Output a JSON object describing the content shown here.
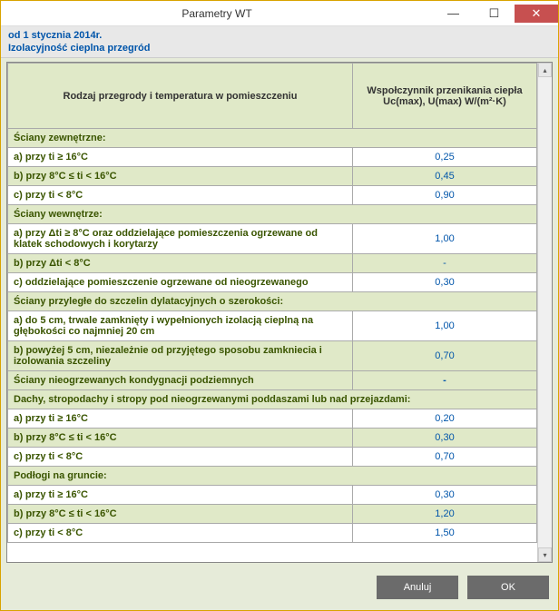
{
  "window": {
    "title": "Parametry WT"
  },
  "info": {
    "line1": "od 1 stycznia 2014r.",
    "line2": "Izolacyjność cieplna przegród"
  },
  "headers": {
    "col1": "Rodzaj przegrody i temperatura w pomieszczeniu",
    "col2": "Wspołczynnik przenikania ciepła Uc(max), U(max) W/(m²·K)"
  },
  "rows": [
    {
      "type": "section",
      "desc": "Ściany zewnętrzne:",
      "val": ""
    },
    {
      "type": "data",
      "desc": "a) przy ti ≥ 16°C",
      "val": "0,25"
    },
    {
      "type": "alt",
      "desc": "b) przy 8°C ≤ ti < 16°C",
      "val": "0,45"
    },
    {
      "type": "data",
      "desc": "c) przy ti < 8°C",
      "val": "0,90"
    },
    {
      "type": "section",
      "desc": "Ściany wewnętrze:",
      "val": ""
    },
    {
      "type": "data",
      "desc": "a) przy Δti ≥ 8°C oraz oddzielające pomieszczenia ogrzewane od klatek schodowych i korytarzy",
      "val": "1,00"
    },
    {
      "type": "alt",
      "desc": "b) przy Δti < 8°C",
      "val": "-"
    },
    {
      "type": "data",
      "desc": "c) oddzielające pomieszczenie ogrzewane od nieogrzewanego",
      "val": "0,30"
    },
    {
      "type": "section",
      "desc": "Ściany przyległe do szczelin dylatacyjnych o szerokości:",
      "val": ""
    },
    {
      "type": "data",
      "desc": "a) do 5 cm, trwale zamknięty i wypełnionych izolacją cieplną na głębokości co najmniej 20 cm",
      "val": "1,00"
    },
    {
      "type": "alt",
      "desc": "b) powyżej 5 cm, niezależnie od przyjętego sposobu zamkniecia i izolowania szczeliny",
      "val": "0,70"
    },
    {
      "type": "section",
      "desc": "Ściany nieogrzewanych kondygnacji podziemnych",
      "val": "-"
    },
    {
      "type": "section",
      "desc": "Dachy, stropodachy i stropy pod nieogrzewanymi poddaszami lub nad przejazdami:",
      "val": ""
    },
    {
      "type": "data",
      "desc": "a) przy ti ≥ 16°C",
      "val": "0,20"
    },
    {
      "type": "alt",
      "desc": "b) przy 8°C ≤ ti < 16°C",
      "val": "0,30"
    },
    {
      "type": "data",
      "desc": "c) przy ti < 8°C",
      "val": "0,70"
    },
    {
      "type": "section",
      "desc": "Podłogi na gruncie:",
      "val": ""
    },
    {
      "type": "data",
      "desc": "a) przy ti ≥ 16°C",
      "val": "0,30"
    },
    {
      "type": "alt",
      "desc": "b) przy 8°C ≤ ti < 16°C",
      "val": "1,20"
    },
    {
      "type": "data",
      "desc": "c) przy ti < 8°C",
      "val": "1,50"
    }
  ],
  "buttons": {
    "cancel": "Anuluj",
    "ok": "OK"
  },
  "icons": {
    "min": "—",
    "max": "☐",
    "close": "✕",
    "up": "▴",
    "down": "▾"
  }
}
